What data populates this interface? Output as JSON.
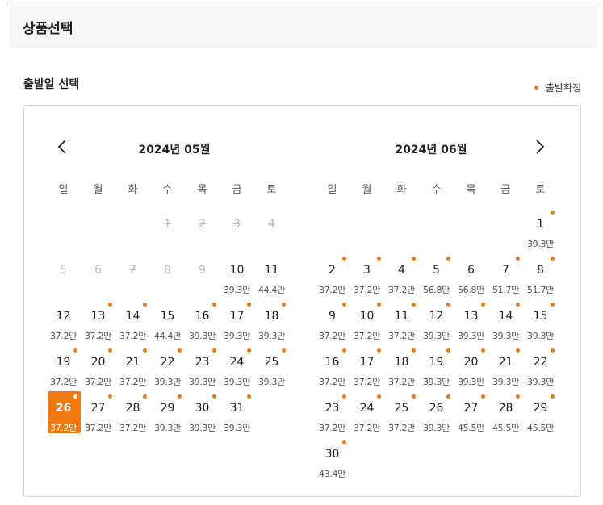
{
  "header": {
    "title": "상품선택"
  },
  "section": {
    "title": "출발일 선택",
    "legend_label": "출발확정"
  },
  "weekdays": [
    "일",
    "월",
    "화",
    "수",
    "목",
    "금",
    "토"
  ],
  "months": [
    {
      "title": "2024년 05월",
      "first_weekday": 3,
      "days": [
        {
          "d": "1",
          "price": "",
          "dot": false,
          "state": "struck"
        },
        {
          "d": "2",
          "price": "",
          "dot": false,
          "state": "struck"
        },
        {
          "d": "3",
          "price": "",
          "dot": false,
          "state": "struck"
        },
        {
          "d": "4",
          "price": "",
          "dot": false,
          "state": "struck"
        },
        {
          "d": "5",
          "price": "",
          "dot": false,
          "state": "disabled"
        },
        {
          "d": "6",
          "price": "",
          "dot": false,
          "state": "disabled"
        },
        {
          "d": "7",
          "price": "",
          "dot": false,
          "state": "struck"
        },
        {
          "d": "8",
          "price": "",
          "dot": false,
          "state": "disabled"
        },
        {
          "d": "9",
          "price": "",
          "dot": false,
          "state": "disabled"
        },
        {
          "d": "10",
          "price": "39.3만",
          "dot": false,
          "state": ""
        },
        {
          "d": "11",
          "price": "44.4만",
          "dot": false,
          "state": ""
        },
        {
          "d": "12",
          "price": "37.2만",
          "dot": false,
          "state": ""
        },
        {
          "d": "13",
          "price": "37.2만",
          "dot": true,
          "state": ""
        },
        {
          "d": "14",
          "price": "37.2만",
          "dot": true,
          "state": ""
        },
        {
          "d": "15",
          "price": "44.4만",
          "dot": false,
          "state": ""
        },
        {
          "d": "16",
          "price": "39.3만",
          "dot": true,
          "state": ""
        },
        {
          "d": "17",
          "price": "39.3만",
          "dot": true,
          "state": ""
        },
        {
          "d": "18",
          "price": "39.3만",
          "dot": true,
          "state": ""
        },
        {
          "d": "19",
          "price": "37.2만",
          "dot": true,
          "state": ""
        },
        {
          "d": "20",
          "price": "37.2만",
          "dot": true,
          "state": ""
        },
        {
          "d": "21",
          "price": "37.2만",
          "dot": true,
          "state": ""
        },
        {
          "d": "22",
          "price": "39.3만",
          "dot": true,
          "state": ""
        },
        {
          "d": "23",
          "price": "39.3만",
          "dot": true,
          "state": ""
        },
        {
          "d": "24",
          "price": "39.3만",
          "dot": true,
          "state": ""
        },
        {
          "d": "25",
          "price": "39.3만",
          "dot": true,
          "state": ""
        },
        {
          "d": "26",
          "price": "37.2만",
          "dot": true,
          "state": "selected"
        },
        {
          "d": "27",
          "price": "37.2만",
          "dot": true,
          "state": ""
        },
        {
          "d": "28",
          "price": "37.2만",
          "dot": true,
          "state": ""
        },
        {
          "d": "29",
          "price": "39.3만",
          "dot": true,
          "state": ""
        },
        {
          "d": "30",
          "price": "39.3만",
          "dot": true,
          "state": ""
        },
        {
          "d": "31",
          "price": "39.3만",
          "dot": true,
          "state": ""
        }
      ]
    },
    {
      "title": "2024년 06월",
      "first_weekday": 6,
      "days": [
        {
          "d": "1",
          "price": "39.3만",
          "dot": true,
          "state": ""
        },
        {
          "d": "2",
          "price": "37.2만",
          "dot": true,
          "state": ""
        },
        {
          "d": "3",
          "price": "37.2만",
          "dot": true,
          "state": ""
        },
        {
          "d": "4",
          "price": "37.2만",
          "dot": true,
          "state": ""
        },
        {
          "d": "5",
          "price": "56.8만",
          "dot": true,
          "state": ""
        },
        {
          "d": "6",
          "price": "56.8만",
          "dot": false,
          "state": ""
        },
        {
          "d": "7",
          "price": "51.7만",
          "dot": true,
          "state": ""
        },
        {
          "d": "8",
          "price": "51.7만",
          "dot": true,
          "state": ""
        },
        {
          "d": "9",
          "price": "37.2만",
          "dot": true,
          "state": ""
        },
        {
          "d": "10",
          "price": "37.2만",
          "dot": true,
          "state": ""
        },
        {
          "d": "11",
          "price": "37.2만",
          "dot": true,
          "state": ""
        },
        {
          "d": "12",
          "price": "39.3만",
          "dot": true,
          "state": ""
        },
        {
          "d": "13",
          "price": "39.3만",
          "dot": true,
          "state": ""
        },
        {
          "d": "14",
          "price": "39.3만",
          "dot": true,
          "state": ""
        },
        {
          "d": "15",
          "price": "39.3만",
          "dot": true,
          "state": ""
        },
        {
          "d": "16",
          "price": "37.2만",
          "dot": true,
          "state": ""
        },
        {
          "d": "17",
          "price": "37.2만",
          "dot": true,
          "state": ""
        },
        {
          "d": "18",
          "price": "37.2만",
          "dot": true,
          "state": ""
        },
        {
          "d": "19",
          "price": "39.3만",
          "dot": true,
          "state": ""
        },
        {
          "d": "20",
          "price": "39.3만",
          "dot": true,
          "state": ""
        },
        {
          "d": "21",
          "price": "39.3만",
          "dot": true,
          "state": ""
        },
        {
          "d": "22",
          "price": "39.3만",
          "dot": true,
          "state": ""
        },
        {
          "d": "23",
          "price": "37.2만",
          "dot": true,
          "state": ""
        },
        {
          "d": "24",
          "price": "37.2만",
          "dot": true,
          "state": ""
        },
        {
          "d": "25",
          "price": "37.2만",
          "dot": true,
          "state": ""
        },
        {
          "d": "26",
          "price": "39.3만",
          "dot": true,
          "state": ""
        },
        {
          "d": "27",
          "price": "45.5만",
          "dot": true,
          "state": ""
        },
        {
          "d": "28",
          "price": "45.5만",
          "dot": true,
          "state": ""
        },
        {
          "d": "29",
          "price": "45.5만",
          "dot": true,
          "state": ""
        },
        {
          "d": "30",
          "price": "43.4만",
          "dot": true,
          "state": ""
        }
      ]
    }
  ],
  "colors": {
    "accent": "#f07a10",
    "disabled": "#bbbbbb"
  },
  "nav": {
    "prev_icon": "chevron-left-icon",
    "next_icon": "chevron-right-icon"
  }
}
